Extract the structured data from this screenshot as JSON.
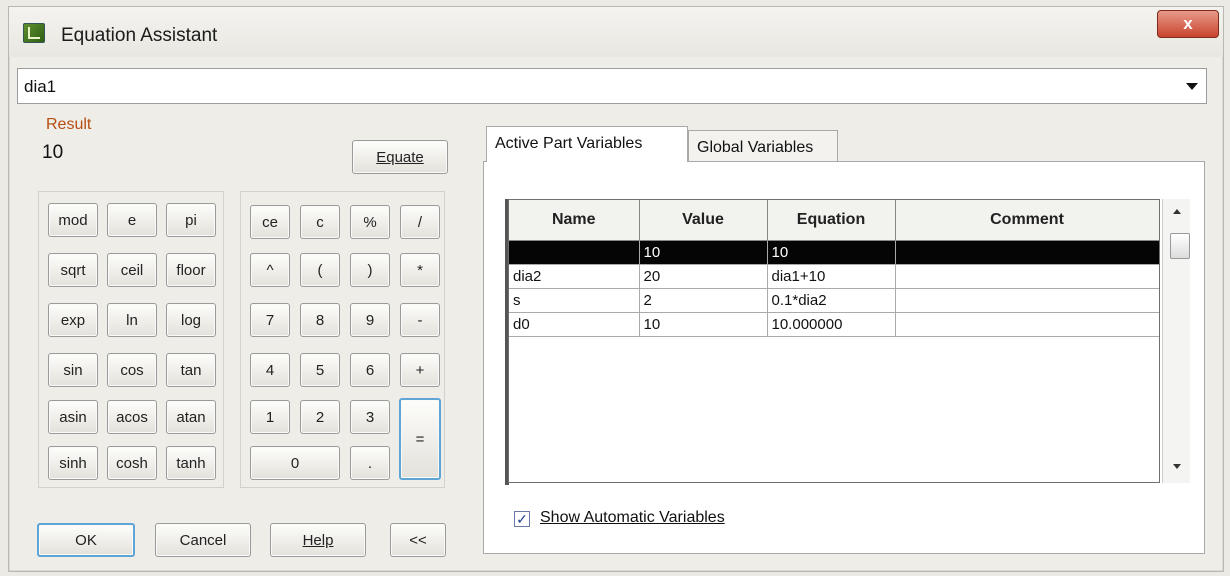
{
  "window": {
    "title": "Equation Assistant",
    "close_label": "x"
  },
  "expression": {
    "value": "dia1"
  },
  "result": {
    "label": "Result",
    "value": "10"
  },
  "equate_button": {
    "label": "Equate"
  },
  "func_keys": [
    "mod",
    "e",
    "pi",
    "sqrt",
    "ceil",
    "floor",
    "exp",
    "ln",
    "log",
    "sin",
    "cos",
    "tan",
    "asin",
    "acos",
    "atan",
    "sinh",
    "cosh",
    "tanh"
  ],
  "num_keys": {
    "r1": [
      "ce",
      "c",
      "%",
      "/"
    ],
    "r2": [
      "^",
      "(",
      ")",
      "*"
    ],
    "r3": [
      "7",
      "8",
      "9",
      "-"
    ],
    "r4": [
      "4",
      "5",
      "6",
      "+"
    ],
    "r5": [
      "1",
      "2",
      "3"
    ],
    "zero": "0",
    "dot": ".",
    "equals": "="
  },
  "buttons": {
    "ok": "OK",
    "cancel": "Cancel",
    "help": "Help",
    "collapse": "<<"
  },
  "tabs": [
    "Active Part Variables",
    "Global Variables"
  ],
  "table": {
    "headers": [
      "Name",
      "Value",
      "Equation",
      "Comment"
    ],
    "rows": [
      [
        "",
        "10",
        "10",
        ""
      ],
      [
        "dia2",
        "20",
        "dia1+10",
        ""
      ],
      [
        "s",
        "2",
        "0.1*dia2",
        ""
      ],
      [
        "d0",
        "10",
        "10.000000",
        ""
      ]
    ]
  },
  "show_automatic": {
    "label": "Show Automatic Variables",
    "checked": true,
    "mark": "✓"
  }
}
